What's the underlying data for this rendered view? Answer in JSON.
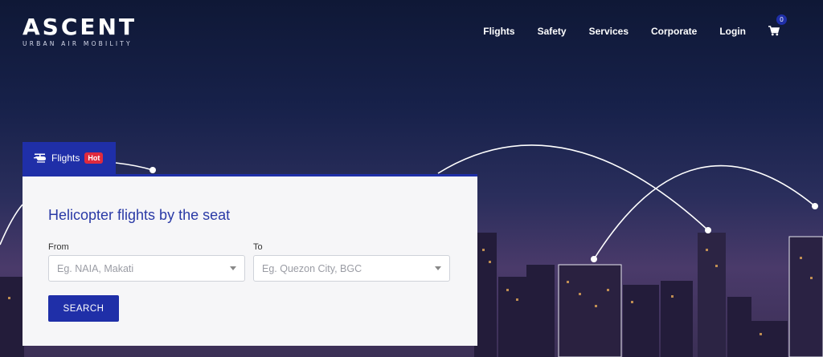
{
  "brand": {
    "name": "ASCENT",
    "tagline": "URBAN AIR MOBILITY"
  },
  "nav": {
    "items": [
      "Flights",
      "Safety",
      "Services",
      "Corporate",
      "Login"
    ],
    "cart_count": "0"
  },
  "tabs": {
    "flights_label": "Flights",
    "hot_badge": "Hot"
  },
  "form": {
    "title": "Helicopter flights by the seat",
    "from_label": "From",
    "from_placeholder": "Eg. NAIA, Makati",
    "to_label": "To",
    "to_placeholder": "Eg. Quezon City, BGC",
    "search_label": "SEARCH"
  },
  "colors": {
    "primary": "#1f2fa8",
    "hot": "#e02a3e",
    "sky_top": "#0f1836"
  }
}
